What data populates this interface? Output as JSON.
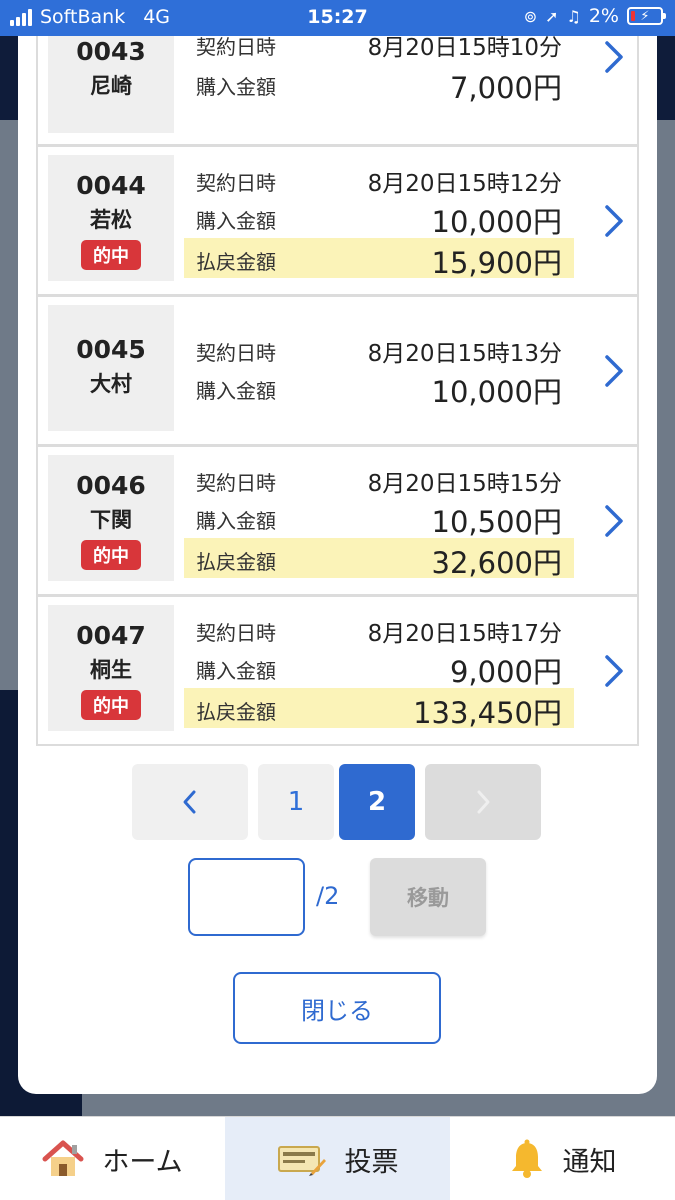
{
  "status_bar": {
    "carrier": "SoftBank",
    "network": "4G",
    "time": "15:27",
    "battery": "2%"
  },
  "labels": {
    "contract_datetime": "契約日時",
    "purchase_amount": "購入金額",
    "payout_amount": "払戻金額",
    "hit_badge": "的中"
  },
  "tickets": [
    {
      "code": "0043",
      "venue": "尼崎",
      "hit": false,
      "datetime": "8月20日15時10分",
      "purchase": "7,000円",
      "payout": ""
    },
    {
      "code": "0044",
      "venue": "若松",
      "hit": true,
      "datetime": "8月20日15時12分",
      "purchase": "10,000円",
      "payout": "15,900円"
    },
    {
      "code": "0045",
      "venue": "大村",
      "hit": false,
      "datetime": "8月20日15時13分",
      "purchase": "10,000円",
      "payout": ""
    },
    {
      "code": "0046",
      "venue": "下関",
      "hit": true,
      "datetime": "8月20日15時15分",
      "purchase": "10,500円",
      "payout": "32,600円"
    },
    {
      "code": "0047",
      "venue": "桐生",
      "hit": true,
      "datetime": "8月20日15時17分",
      "purchase": "9,000円",
      "payout": "133,450円"
    }
  ],
  "pagination": {
    "prev": "<",
    "pages": [
      "1",
      "2"
    ],
    "current": "2",
    "next": ">",
    "page_input_value": "",
    "total": "/2",
    "move_label": "移動"
  },
  "close_label": "閉じる",
  "tabbar": {
    "home": "ホーム",
    "vote": "投票",
    "notify": "通知"
  },
  "colors": {
    "accent": "#2f6ad0",
    "hit": "#d8363a",
    "payout_bg": "#fbf3b8"
  }
}
